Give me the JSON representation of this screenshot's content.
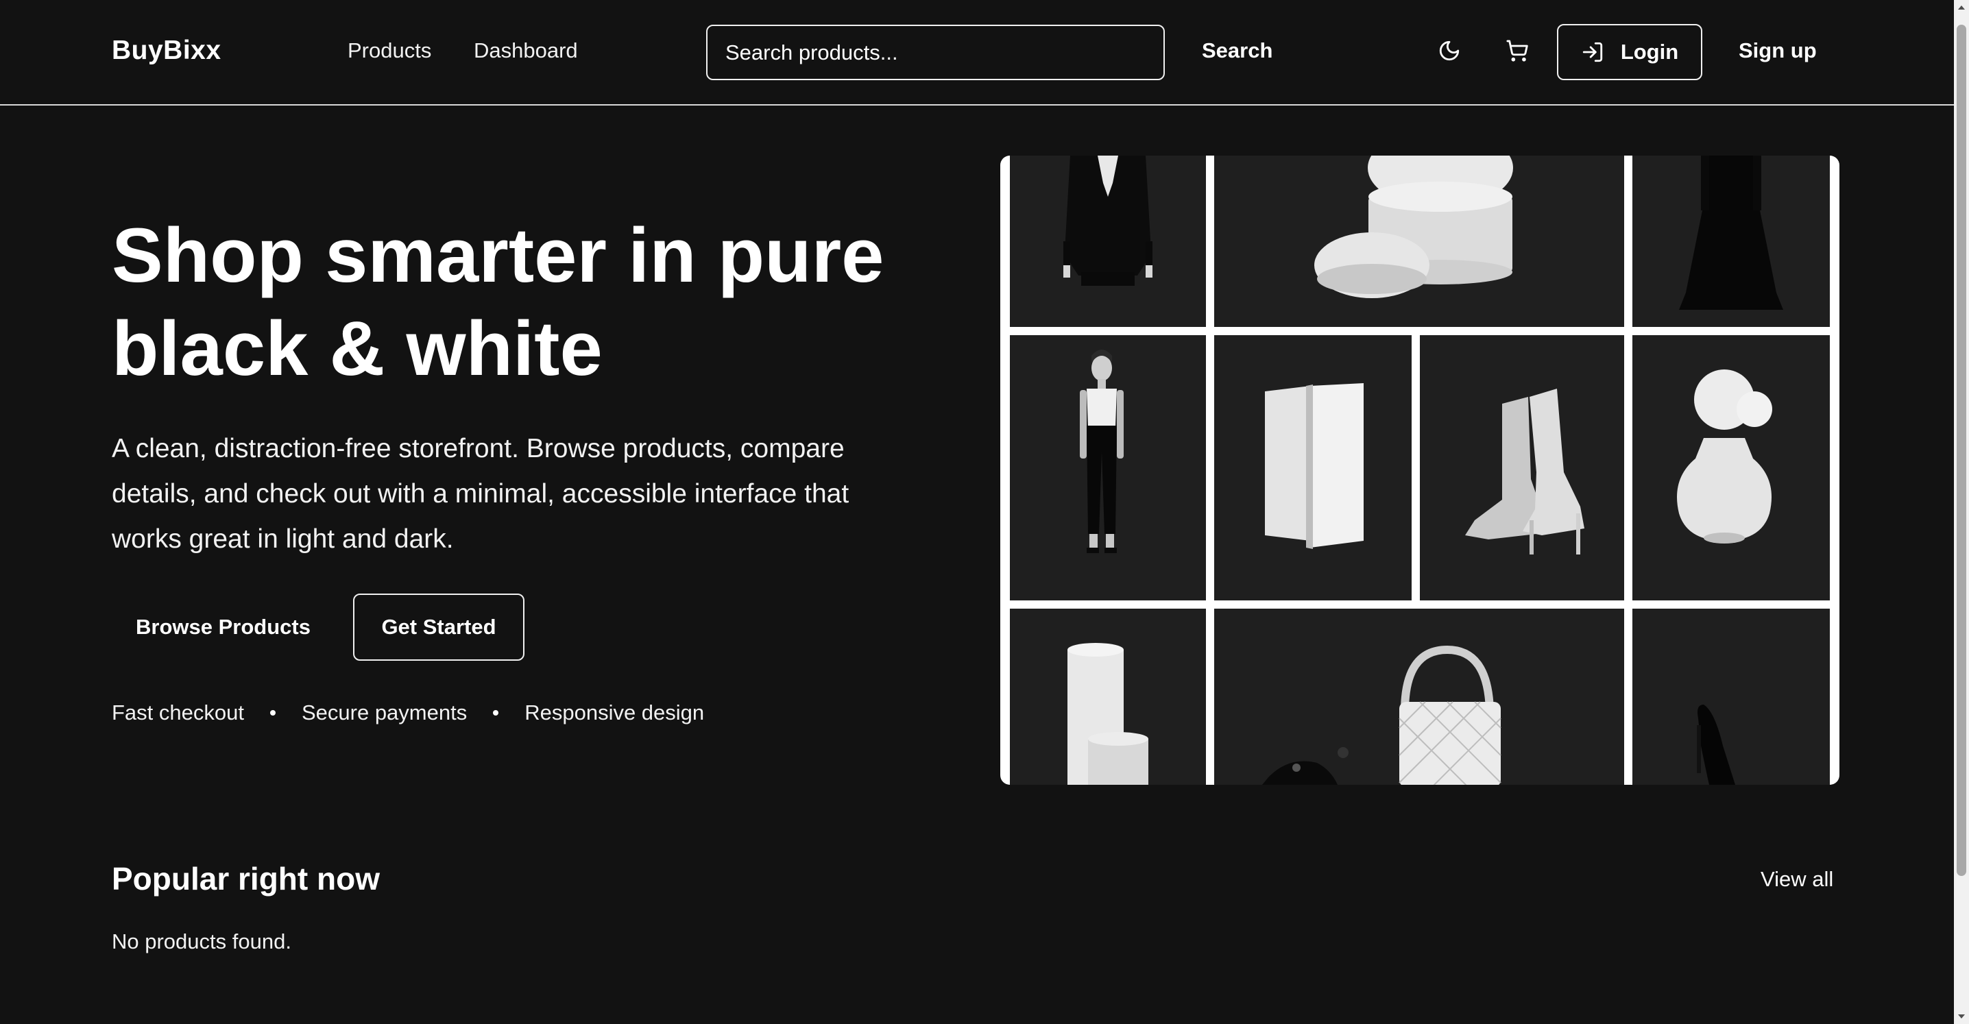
{
  "header": {
    "brand": "BuyBixx",
    "nav": [
      "Products",
      "Dashboard"
    ],
    "search_placeholder": "Search products...",
    "search_label": "Search",
    "login_label": "Login",
    "signup_label": "Sign up",
    "icons": [
      "moon-icon",
      "cart-icon",
      "login-arrow-icon"
    ]
  },
  "hero": {
    "title_line1": "Shop smarter in pure",
    "title_line2": "black & white",
    "subtitle_line1": "A clean, distraction-free storefront. Browse products, compare",
    "subtitle_line2": "details, and check out with a minimal, accessible interface that",
    "subtitle_line3": "works great in light and dark.",
    "browse_label": "Browse Products",
    "started_label": "Get Started",
    "features": [
      "Fast checkout",
      "Secure payments",
      "Responsive design"
    ]
  },
  "popular": {
    "title": "Popular right now",
    "view_all": "View all",
    "empty": "No products found."
  },
  "colors": {
    "background": "#121212",
    "text": "#ffffff",
    "tile": "#1f1f1f",
    "grid_border": "#ffffff"
  }
}
